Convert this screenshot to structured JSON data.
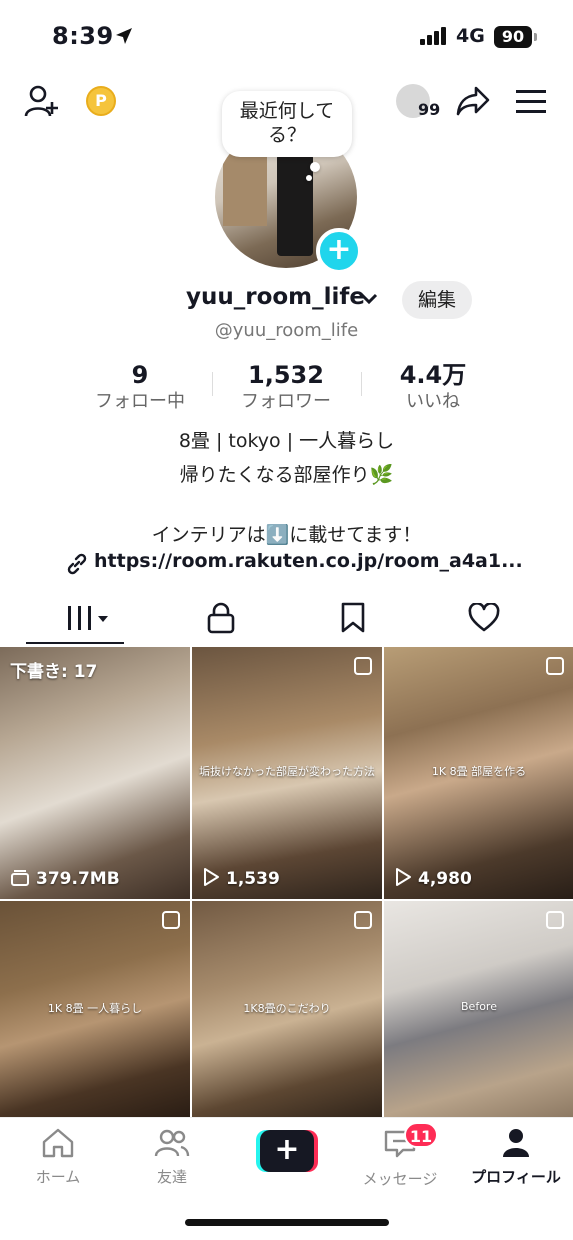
{
  "status_bar": {
    "time": "8:39",
    "network": "4G",
    "battery": "90"
  },
  "header": {
    "coin_label": "P",
    "visitor_count": "99",
    "bubble_text": "最近何してる？"
  },
  "profile": {
    "username": "yuu_room_life",
    "handle": "@yuu_room_life",
    "edit_label": "編集",
    "stats": [
      {
        "value": "9",
        "label": "フォロー中"
      },
      {
        "value": "1,532",
        "label": "フォロワー"
      },
      {
        "value": "4.4万",
        "label": "いいね"
      }
    ],
    "bio_line1": "8畳 | tokyo | 一人暮らし",
    "bio_line2": "帰りたくなる部屋作り🌿",
    "bio_line3": "インテリアは⬇️に載せてます！",
    "link": "https://room.rakuten.co.jp/room_a4a1..."
  },
  "tabs": [
    "videos",
    "private",
    "saved",
    "liked"
  ],
  "grid": [
    {
      "draft_label": "下書き: 17",
      "stat": "379.7MB",
      "caption": ""
    },
    {
      "draft_label": "",
      "stat": "1,539",
      "caption": "垢抜けなかった部屋が変わった方法"
    },
    {
      "draft_label": "",
      "stat": "4,980",
      "caption": "1K 8畳 部屋を作る"
    },
    {
      "draft_label": "",
      "stat": "",
      "caption": "1K 8畳 一人暮らし"
    },
    {
      "draft_label": "",
      "stat": "",
      "caption": "1K8畳のこだわり"
    },
    {
      "draft_label": "",
      "stat": "",
      "caption": "Before"
    }
  ],
  "bottom_nav": {
    "home": "ホーム",
    "friends": "友達",
    "messages": "メッセージ",
    "messages_badge": "11",
    "profile": "プロフィール"
  },
  "colors": {
    "accent_cyan": "#20d5ec",
    "accent_red": "#fe2c55",
    "text": "#161823"
  }
}
